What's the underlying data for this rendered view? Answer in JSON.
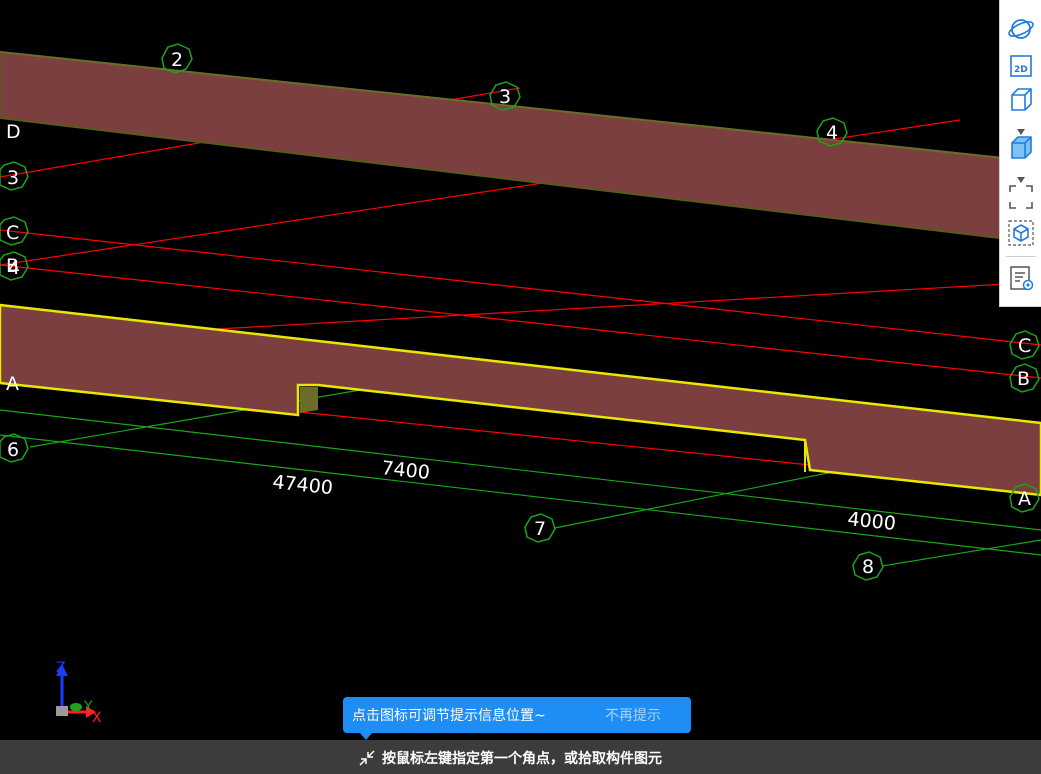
{
  "viewport": {
    "grid_labels": {
      "top_2": "2",
      "top_3": "3",
      "top_4": "4",
      "left_D": "D",
      "left_3": "3",
      "left_C": "C",
      "left_B": "B",
      "left_4": "4",
      "left_A": "A",
      "left_6": "6",
      "right_C": "C",
      "right_B": "B",
      "right_A": "A",
      "bottom_7": "7",
      "bottom_8": "8"
    },
    "dimensions": {
      "d7400": "7400",
      "d47400": "47400",
      "d4000": "4000"
    },
    "colors": {
      "beam": "#7b3f3f",
      "axis_red": "#ff0000",
      "axis_green": "#1aa51a",
      "highlight": "#e8e800"
    }
  },
  "toolbar": {
    "items": [
      "orbit-icon",
      "view-2d-icon",
      "view-3d-cube-icon",
      "shaded-cube-icon",
      "fit-window-icon",
      "view-cube-icon",
      "properties-display-icon"
    ],
    "view_2d_label": "2D"
  },
  "hint": {
    "message": "点击图标可调节提示信息位置~",
    "dismiss": "不再提示"
  },
  "status": {
    "prompt": "按鼠标左键指定第一个角点，或拾取构件图元"
  },
  "axes_gizmo": {
    "z": "Z",
    "y": "Y",
    "x": "X"
  }
}
